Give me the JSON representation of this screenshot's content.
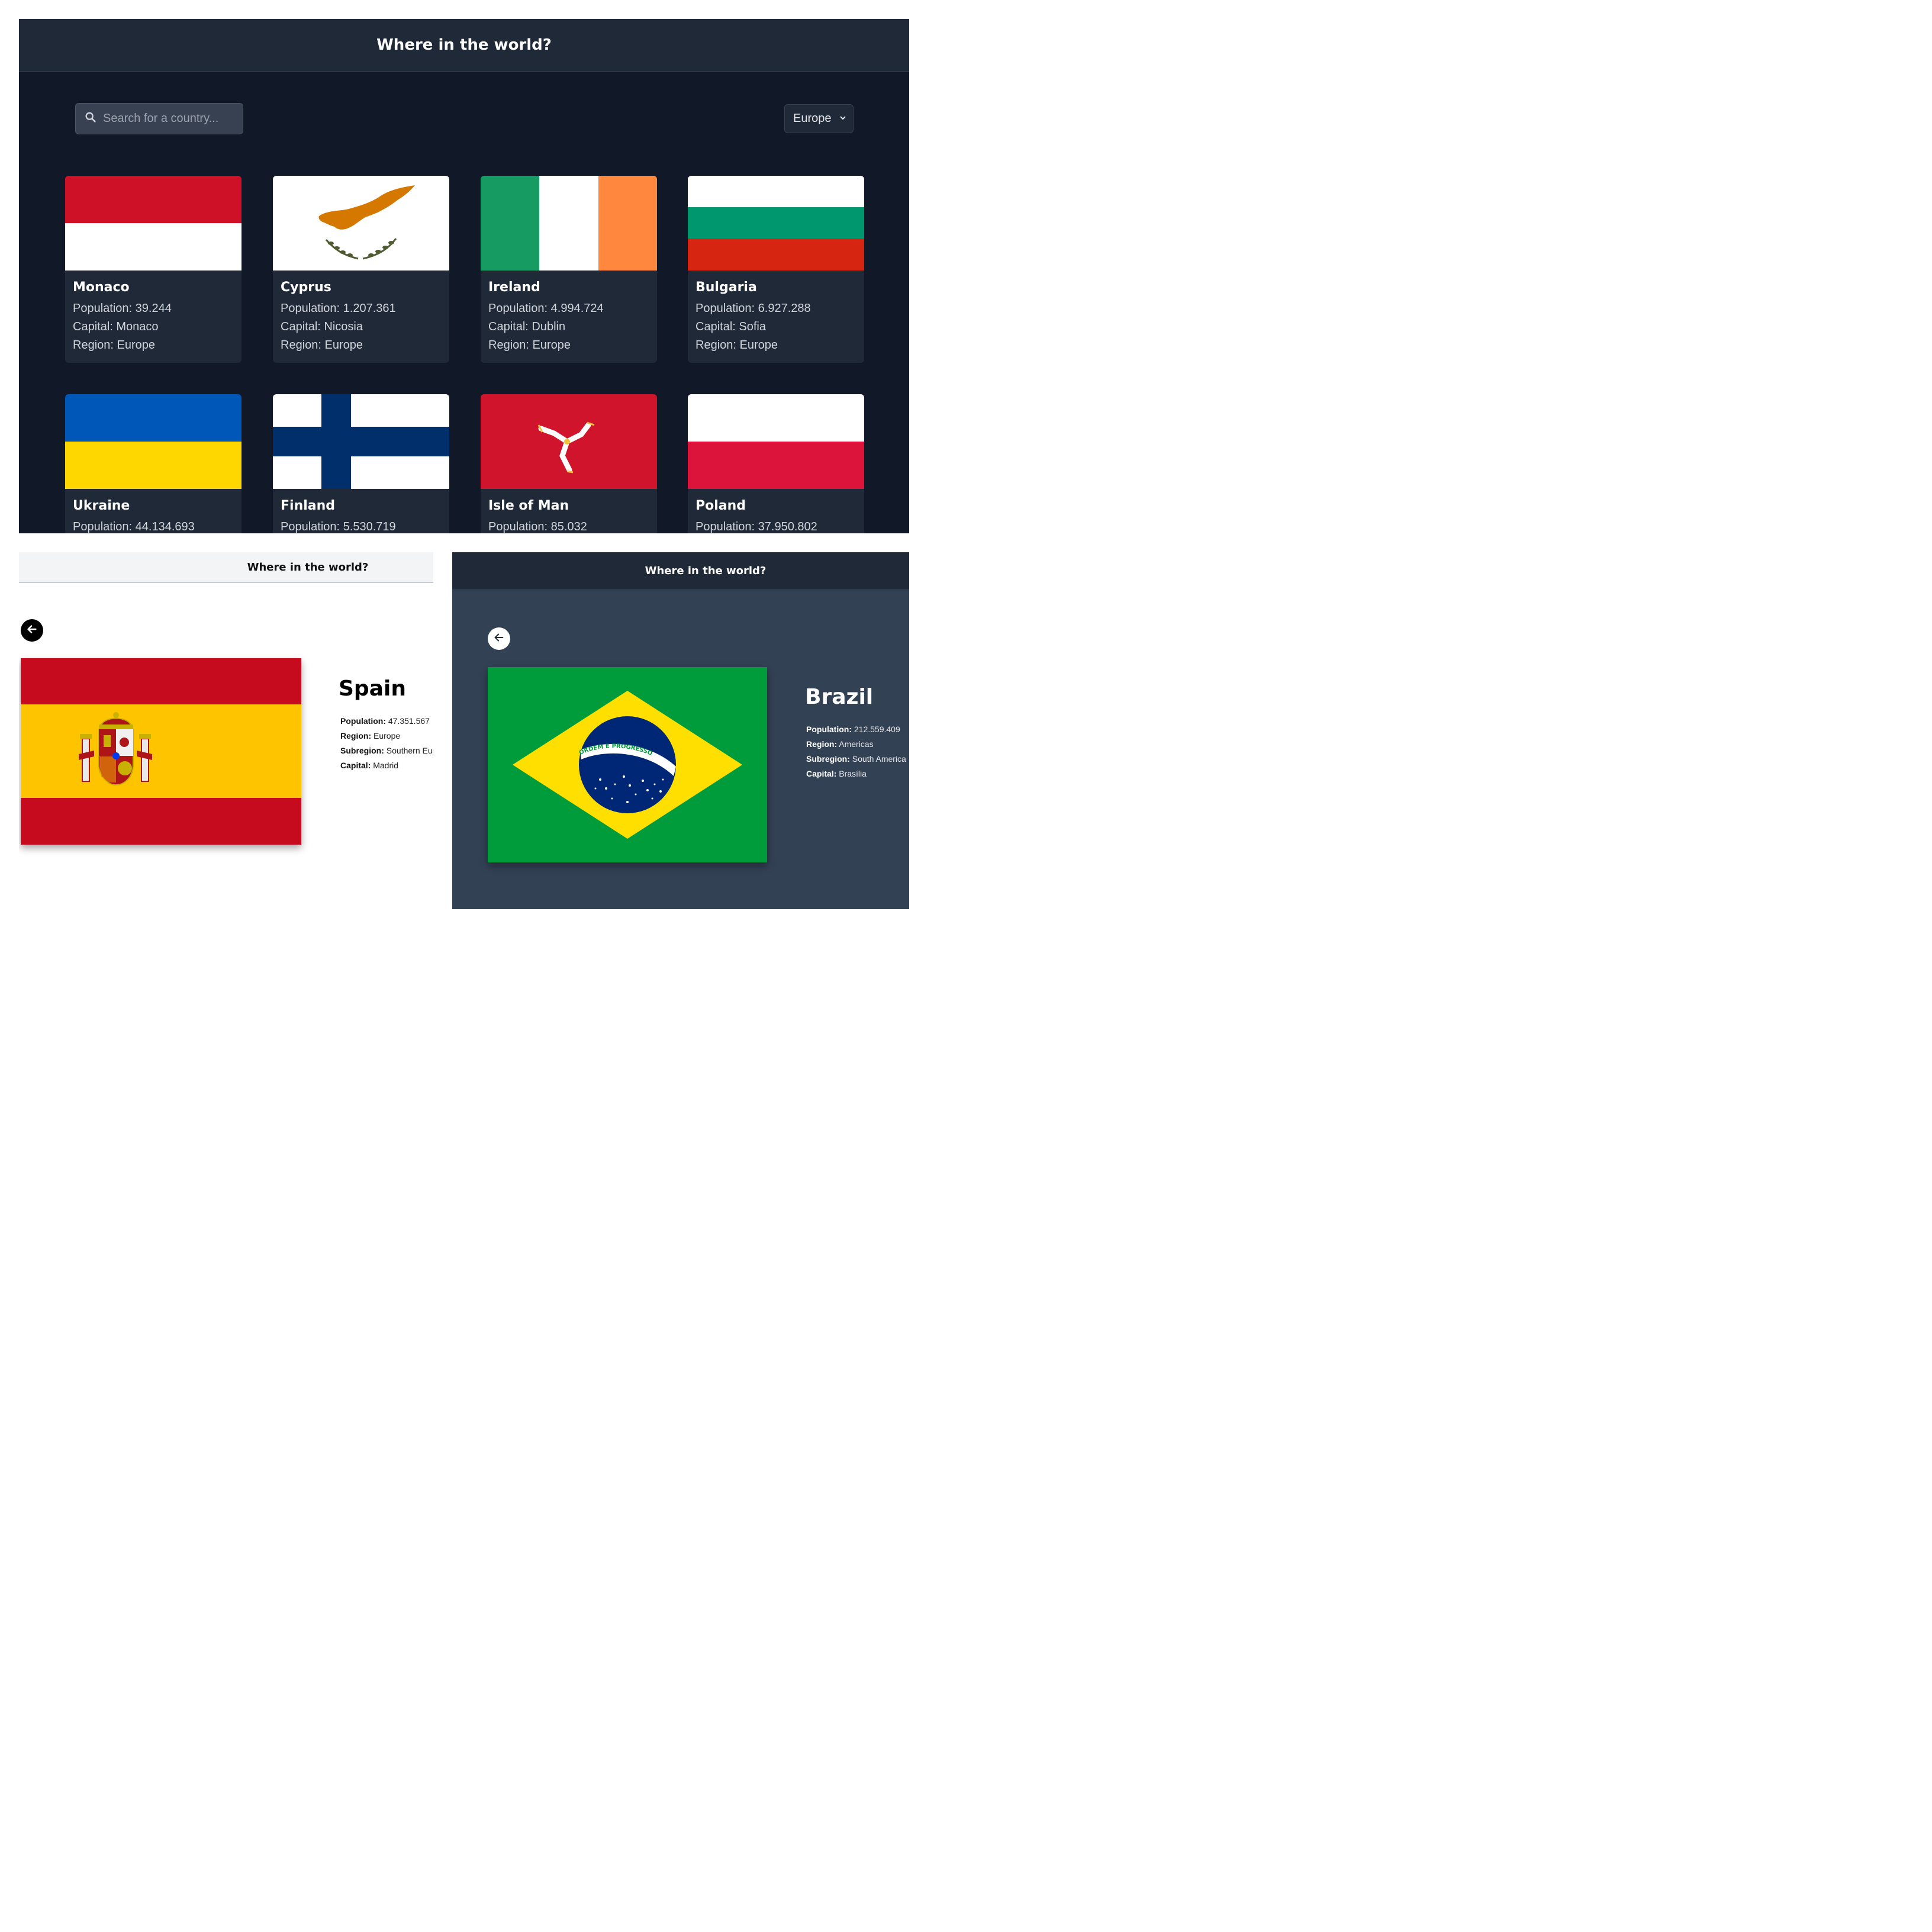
{
  "list_view": {
    "header": {
      "title": "Where in the world?"
    },
    "search": {
      "placeholder": "Search for a country..."
    },
    "region_filter": {
      "selected": "Europe"
    },
    "labels": {
      "population": "Population:",
      "capital": "Capital:",
      "region": "Region:"
    },
    "cards": [
      {
        "name": "Monaco",
        "population": "39.244",
        "capital": "Monaco",
        "region": "Europe"
      },
      {
        "name": "Cyprus",
        "population": "1.207.361",
        "capital": "Nicosia",
        "region": "Europe"
      },
      {
        "name": "Ireland",
        "population": "4.994.724",
        "capital": "Dublin",
        "region": "Europe"
      },
      {
        "name": "Bulgaria",
        "population": "6.927.288",
        "capital": "Sofia",
        "region": "Europe"
      },
      {
        "name": "Ukraine",
        "population": "44.134.693",
        "capital": "",
        "region": ""
      },
      {
        "name": "Finland",
        "population": "5.530.719",
        "capital": "",
        "region": ""
      },
      {
        "name": "Isle of Man",
        "population": "85.032",
        "capital": "",
        "region": ""
      },
      {
        "name": "Poland",
        "population": "37.950.802",
        "capital": "",
        "region": ""
      }
    ]
  },
  "detail_light": {
    "header": {
      "title": "Where in the world?"
    },
    "country": {
      "name": "Spain",
      "population": "47.351.567",
      "region": "Europe",
      "subregion": "Southern Europe",
      "capital": "Madrid"
    }
  },
  "detail_dark": {
    "header": {
      "title": "Where in the world?"
    },
    "country": {
      "name": "Brazil",
      "population": "212.559.409",
      "region": "Americas",
      "subregion": "South America",
      "capital": "Brasília",
      "flag_motto": "ORDEM E PROGRESSO"
    }
  },
  "detail_labels": {
    "population": "Population:",
    "region": "Region:",
    "subregion": "Subregion:",
    "capital": "Capital:"
  },
  "colors": {
    "dark_bg": "#111827",
    "dark_element": "#1f2937",
    "slate_bg": "#334155",
    "light_header": "#f3f4f6"
  }
}
